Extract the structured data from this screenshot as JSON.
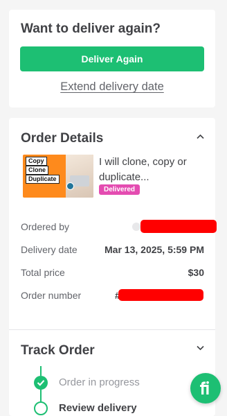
{
  "deliver_again": {
    "title": "Want to deliver again?",
    "button_label": "Deliver Again",
    "extend_link": "Extend delivery date"
  },
  "order_details": {
    "title": "Order Details",
    "gig_title": "I will clone, copy or duplicate...",
    "status_badge": "Delivered",
    "thumbnail": {
      "label_copy": "Copy",
      "label_clone": "Clone",
      "label_duplicate": "Duplicate"
    },
    "rows": [
      {
        "key": "Ordered by",
        "value": ""
      },
      {
        "key": "Delivery date",
        "value": "Mar 13, 2025, 5:59 PM"
      },
      {
        "key": "Total price",
        "value": "$30"
      },
      {
        "key": "Order number",
        "value": "#"
      }
    ]
  },
  "track_order": {
    "title": "Track Order",
    "steps": [
      {
        "label": "Order in progress",
        "state": "done"
      },
      {
        "label": "Review delivery",
        "state": "current"
      }
    ]
  },
  "colors": {
    "accent": "#1dbf73",
    "badge": "#e44cb1",
    "redaction": "#ff0000"
  },
  "icons": [
    "chevron-up-icon",
    "chevron-down-icon",
    "check-icon",
    "fiverr-logo-icon"
  ]
}
